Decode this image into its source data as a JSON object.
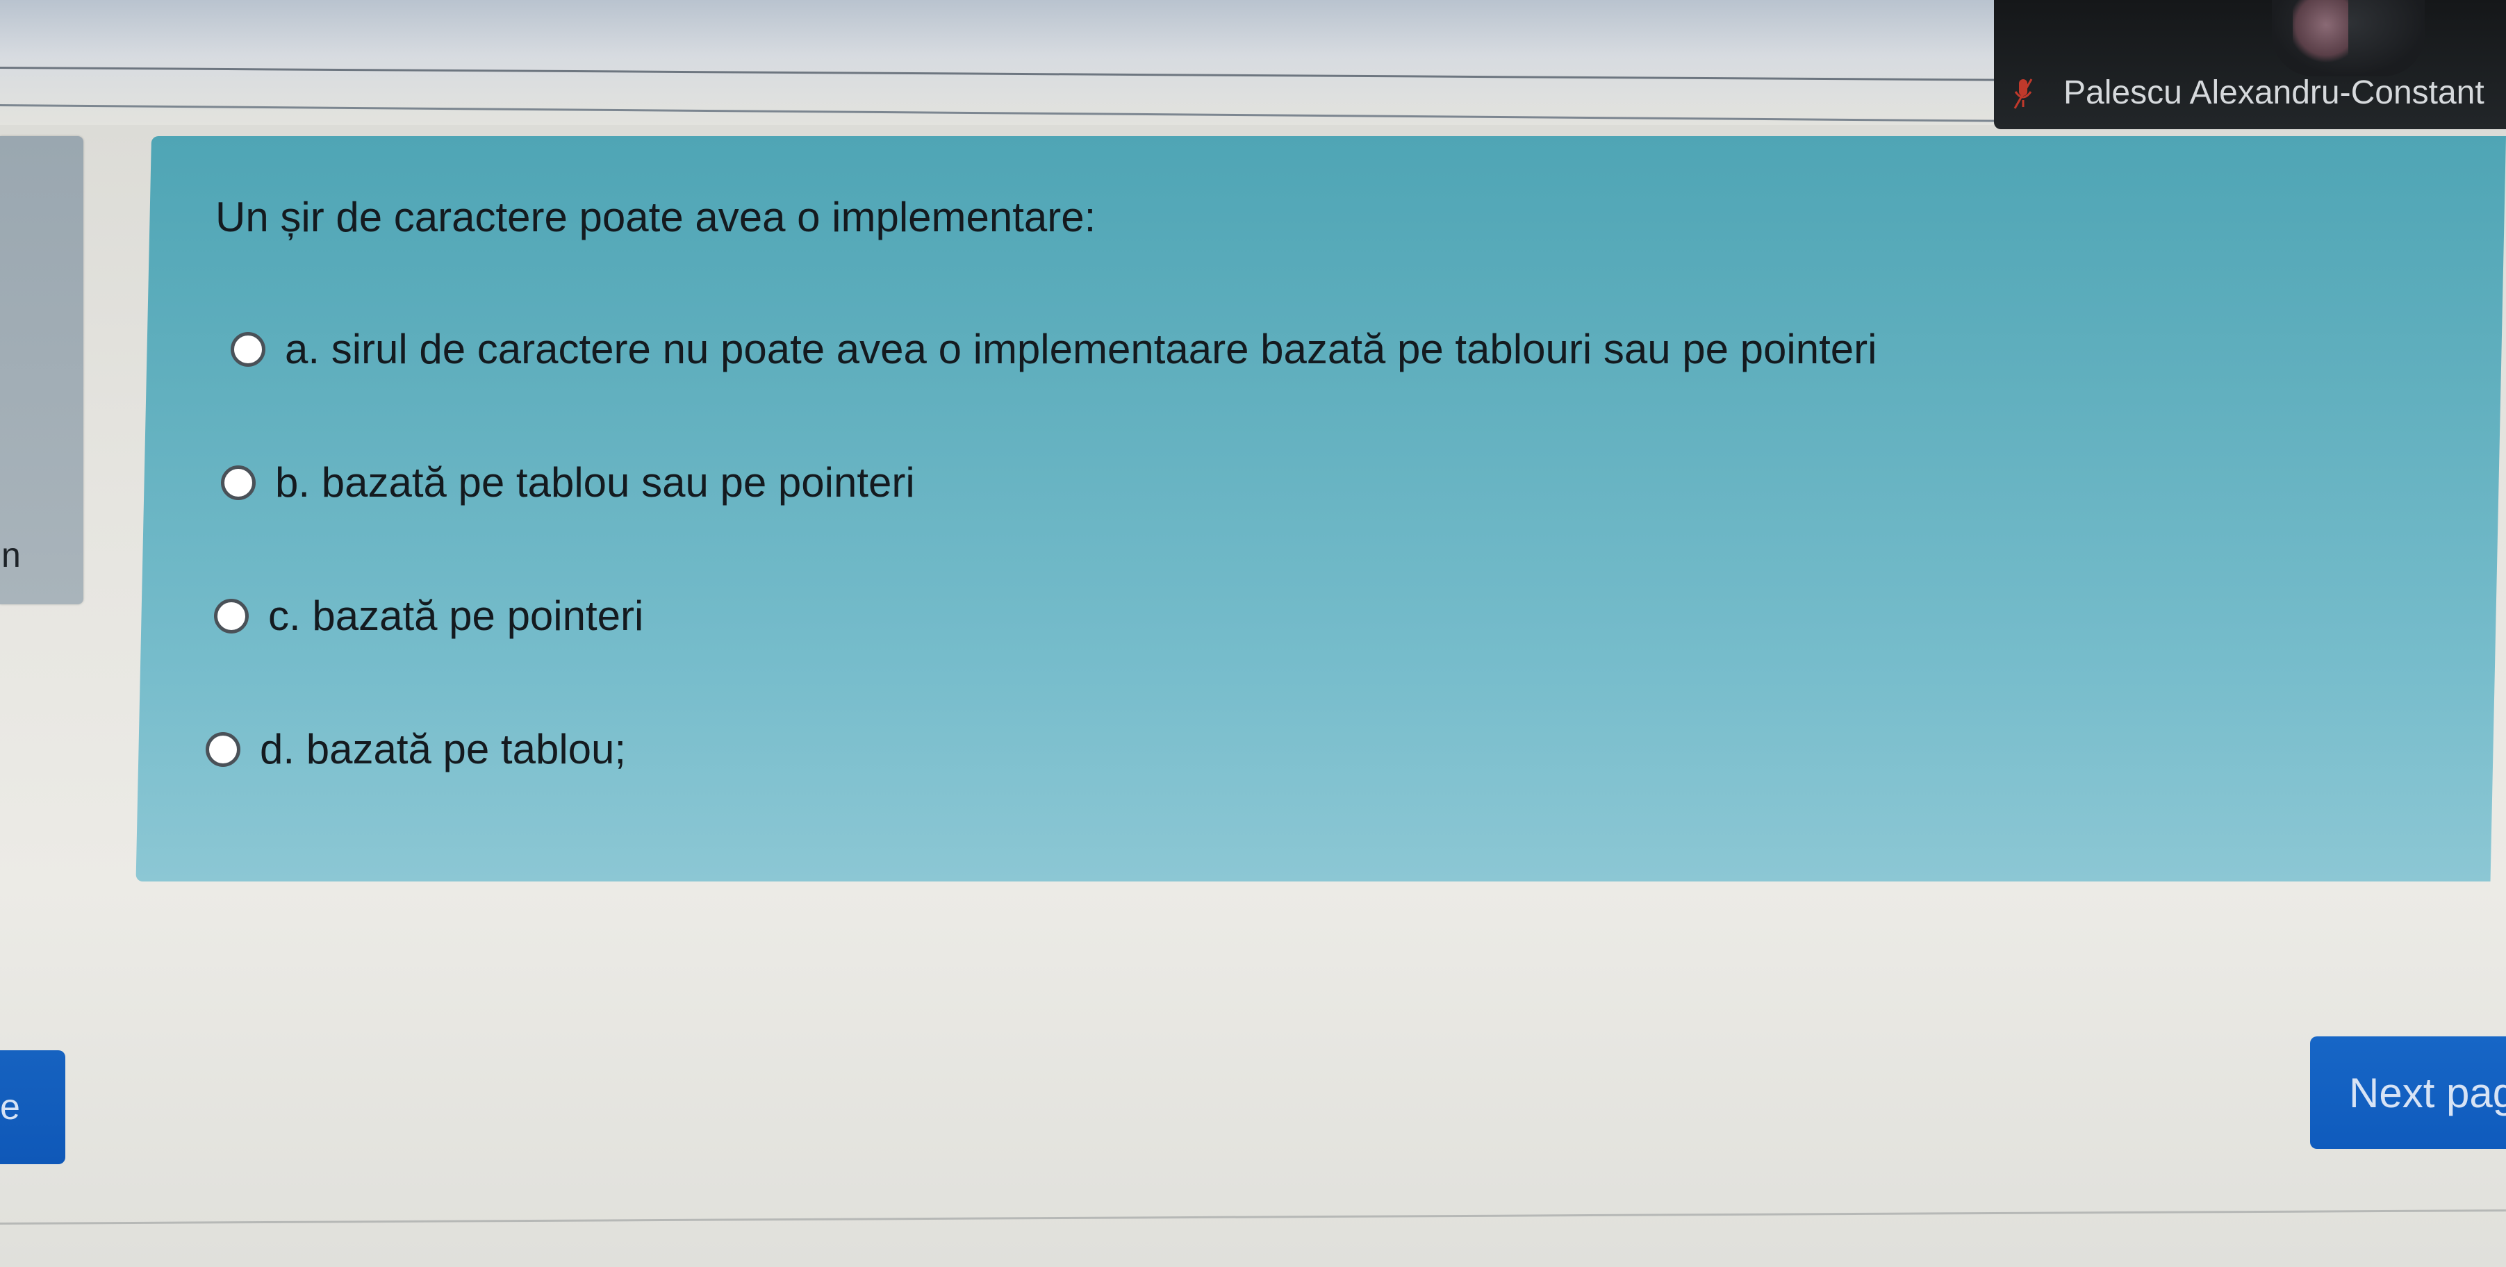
{
  "video": {
    "participant_name": "Palescu Alexandru-Constant",
    "mic_icon": "mic-muted-icon",
    "mic_color": "#c0392b"
  },
  "sidebar": {
    "visible_text": "n"
  },
  "question": {
    "text": "Un șir de caractere poate avea o implementare:",
    "options": [
      {
        "label": "a. sirul de caractere nu poate avea o implementaare bazată pe tablouri sau pe pointeri",
        "selected": false
      },
      {
        "label": "b. bazată pe tablou sau pe pointeri",
        "selected": false
      },
      {
        "label": "c. bazată pe pointeri",
        "selected": false
      },
      {
        "label": "d. bazată pe tablou;",
        "selected": false
      }
    ]
  },
  "navigation": {
    "previous_label": "e",
    "next_label": "Next pag"
  },
  "colors": {
    "card": "#62b0bf",
    "button": "#1262c2",
    "page_background": "#e6e5e0"
  }
}
